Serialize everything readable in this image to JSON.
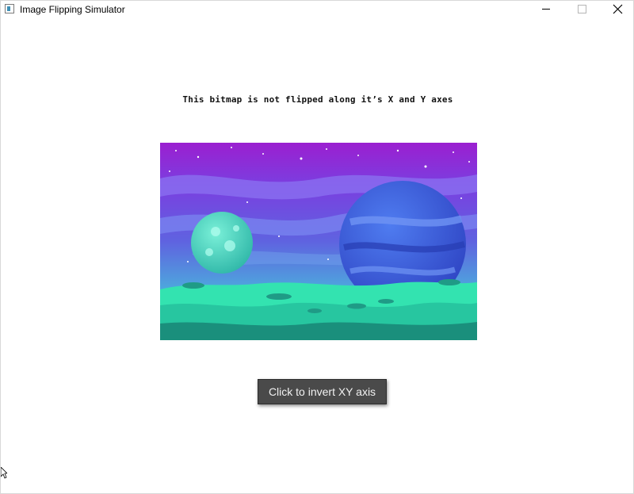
{
  "window": {
    "title": "Image Flipping Simulator",
    "icon": "app-window-icon",
    "controls": [
      "minimize-icon",
      "maximize-icon",
      "close-icon"
    ]
  },
  "main": {
    "caption": "This bitmap is not flipped along it’s X and Y axes",
    "bitmap": {
      "name": "pixel-art-space-landscape",
      "colors": {
        "sky_top": "#9b1fd0",
        "sky_mid": "#5f63e0",
        "sky_low": "#49b8dc",
        "planet_large": "#3f5ed8",
        "planet_small": "#4fd9c0",
        "ground": "#33e3b0",
        "ground_dark": "#1a8f7c"
      }
    },
    "invert_button_label": "Click to invert XY axis"
  }
}
